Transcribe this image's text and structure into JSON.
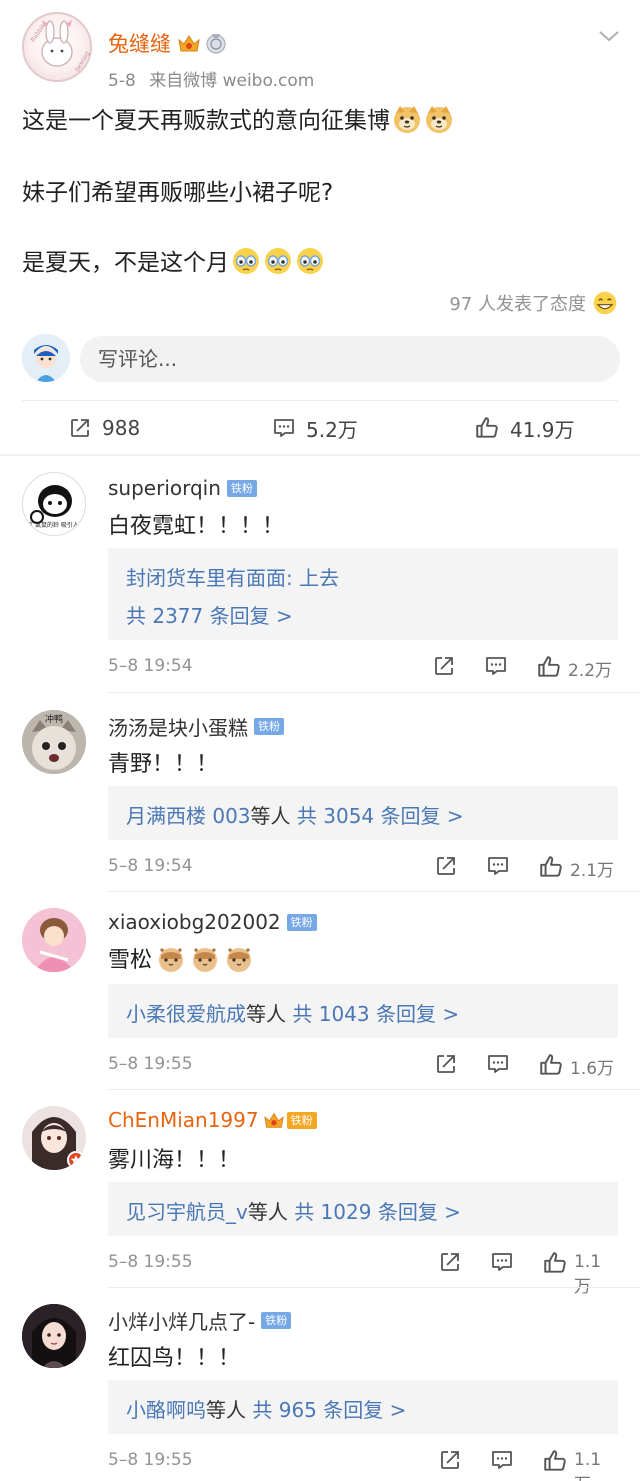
{
  "post": {
    "author": "兔缝缝",
    "date": "5-8",
    "source": "来自微博 weibo.com",
    "avatar_text": "Rabbit Sewing",
    "lines": [
      "这是一个夏天再贩款式的意向征集博",
      "妹子们希望再贩哪些小裙子呢?",
      "是夏天，不是这个月"
    ],
    "attitude_text": "97 人发表了态度"
  },
  "comment_input": {
    "placeholder": "写评论..."
  },
  "actions": {
    "repost": "988",
    "comment": "5.2万",
    "like": "41.9万"
  },
  "fan_badge": "铁粉",
  "comments": [
    {
      "name": "superiorqin",
      "text": "白夜霓虹！！！！",
      "reply_preview": "封闭货车里有面面: 上去",
      "reply_total": "共 2377 条回复 >",
      "time": "5–8 19:54",
      "likes": "2.2万",
      "avatar_caption": "就 这 氣鼠的鈴 吸引人點單"
    },
    {
      "name": "汤汤是块小蛋糕",
      "text": "青野！！！",
      "reply_users": "月满西楼 003",
      "reply_suffix": "等人",
      "reply_total": "共 3054 条回复 >",
      "time": "5–8 19:54",
      "likes": "2.1万",
      "avatar_caption": "冲鸭"
    },
    {
      "name": "xiaoxiobg202002",
      "text": "雪松",
      "reply_users": "小柔很爱航成",
      "reply_suffix": "等人",
      "reply_total": "共 1043 条回复 >",
      "time": "5–8 19:55",
      "likes": "1.6万"
    },
    {
      "name": "ChEnMian1997",
      "text": "雾川海！！！",
      "reply_users": "见习宇航员_v",
      "reply_suffix": "等人",
      "reply_total": "共 1029 条回复 >",
      "time": "5–8 19:55",
      "likes": "1.1万"
    },
    {
      "name": "小烊小烊几点了-",
      "text": "红囚鸟！！！",
      "reply_users": "小酪啊呜",
      "reply_suffix": "等人",
      "reply_total": "共 965 条回复 >",
      "time": "5–8 19:55",
      "likes": "1.1万"
    }
  ]
}
